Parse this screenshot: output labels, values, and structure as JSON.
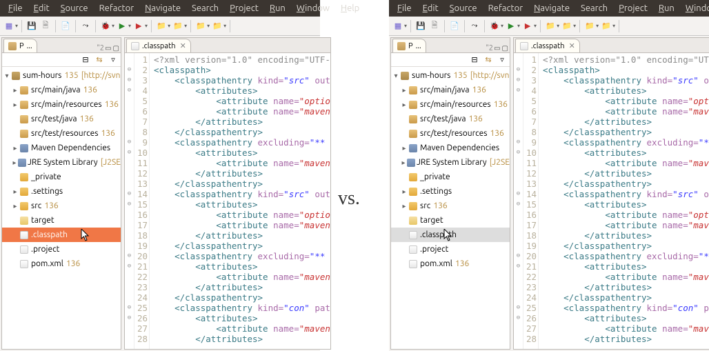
{
  "menus": [
    "File",
    "Edit",
    "Source",
    "Refactor",
    "Navigate",
    "Search",
    "Project",
    "Run",
    "Window",
    "Help"
  ],
  "menus_u": [
    "F",
    "E",
    "S",
    "",
    "N",
    "",
    "P",
    "R",
    "W",
    "H"
  ],
  "vs_label": "vs.",
  "project_tab": "P",
  "bc_label": "\"2",
  "editor_tab": ".classpath",
  "tree": {
    "root": {
      "label": "sum-hours",
      "rev": "135",
      "extra": "[http://svn"
    },
    "items": [
      {
        "label": "src/main/java",
        "rev": "136",
        "icon": "i-pkg",
        "tw": "▸"
      },
      {
        "label": "src/main/resources",
        "rev": "136",
        "icon": "i-pkg",
        "tw": "▸"
      },
      {
        "label": "src/test/java",
        "rev": "136",
        "icon": "i-pkg",
        "tw": ""
      },
      {
        "label": "src/test/resources",
        "rev": "136",
        "icon": "i-pkg",
        "tw": ""
      },
      {
        "label": "Maven Dependencies",
        "rev": "",
        "icon": "i-jar",
        "tw": "▸"
      },
      {
        "label": "JRE System Library",
        "rev": "",
        "extra": "[J2SE",
        "icon": "i-jar",
        "tw": "▸"
      },
      {
        "label": "_private",
        "rev": "",
        "icon": "i-folder",
        "tw": ""
      },
      {
        "label": ".settings",
        "rev": "",
        "icon": "i-folder",
        "tw": "▸"
      },
      {
        "label": "src",
        "rev": "136",
        "icon": "i-folder",
        "tw": "▸"
      },
      {
        "label": "target",
        "rev": "",
        "icon": "i-folder-tgt",
        "tw": ""
      },
      {
        "label": ".classpath",
        "rev": "",
        "icon": "i-file",
        "tw": "",
        "selected": true
      },
      {
        "label": ".project",
        "rev": "",
        "icon": "i-file",
        "tw": ""
      },
      {
        "label": "pom.xml",
        "rev": "136",
        "icon": "i-file",
        "tw": ""
      }
    ]
  },
  "code_lines": [
    {
      "n": 1,
      "f": "",
      "raw": "<span class='xdecl'>&lt;?xml version=&quot;1.0&quot; encoding=&quot;UTF-</span>"
    },
    {
      "n": 2,
      "f": "⊖",
      "raw": "<span class='tagc'>&lt;classpath&gt;</span>"
    },
    {
      "n": 3,
      "f": "⊖",
      "raw": "    <span class='tagc'>&lt;classpathentry</span> <span class='attn'>kind=</span><span class='attv'>&quot;src&quot;</span> <span class='attn'>out</span>"
    },
    {
      "n": 4,
      "f": "⊖",
      "raw": "        <span class='tagc'>&lt;attributes&gt;</span>"
    },
    {
      "n": 5,
      "f": "",
      "raw": "            <span class='tagc'>&lt;attribute</span> <span class='attn'>name=</span><span class='attv-red'>&quot;optio</span>"
    },
    {
      "n": 6,
      "f": "",
      "raw": "            <span class='tagc'>&lt;attribute</span> <span class='attn'>name=</span><span class='attv-red'>&quot;maven</span>"
    },
    {
      "n": 7,
      "f": "",
      "raw": "        <span class='tagc'>&lt;/attributes&gt;</span>"
    },
    {
      "n": 8,
      "f": "",
      "raw": "    <span class='tagc'>&lt;/classpathentry&gt;</span>"
    },
    {
      "n": 9,
      "f": "⊖",
      "raw": "    <span class='tagc'>&lt;classpathentry</span> <span class='attn'>excluding=</span><span class='attv'>&quot;**</span>"
    },
    {
      "n": 10,
      "f": "⊖",
      "raw": "        <span class='tagc'>&lt;attributes&gt;</span>"
    },
    {
      "n": 11,
      "f": "",
      "raw": "            <span class='tagc'>&lt;attribute</span> <span class='attn'>name=</span><span class='attv-red'>&quot;maven</span>"
    },
    {
      "n": 12,
      "f": "",
      "raw": "        <span class='tagc'>&lt;/attributes&gt;</span>"
    },
    {
      "n": 13,
      "f": "",
      "raw": "    <span class='tagc'>&lt;/classpathentry&gt;</span>"
    },
    {
      "n": 14,
      "f": "⊖",
      "raw": "    <span class='tagc'>&lt;classpathentry</span> <span class='attn'>kind=</span><span class='attv'>&quot;src&quot;</span> <span class='attn'>out</span>"
    },
    {
      "n": 15,
      "f": "⊖",
      "raw": "        <span class='tagc'>&lt;attributes&gt;</span>"
    },
    {
      "n": 16,
      "f": "",
      "raw": "            <span class='tagc'>&lt;attribute</span> <span class='attn'>name=</span><span class='attv-red'>&quot;optio</span>"
    },
    {
      "n": 17,
      "f": "",
      "raw": "            <span class='tagc'>&lt;attribute</span> <span class='attn'>name=</span><span class='attv-red'>&quot;maven</span>"
    },
    {
      "n": 18,
      "f": "",
      "raw": "        <span class='tagc'>&lt;/attributes&gt;</span>"
    },
    {
      "n": 19,
      "f": "",
      "raw": "    <span class='tagc'>&lt;/classpathentry&gt;</span>"
    },
    {
      "n": 20,
      "f": "⊖",
      "raw": "    <span class='tagc'>&lt;classpathentry</span> <span class='attn'>excluding=</span><span class='attv'>&quot;**</span>"
    },
    {
      "n": 21,
      "f": "⊖",
      "raw": "        <span class='tagc'>&lt;attributes&gt;</span>"
    },
    {
      "n": 22,
      "f": "",
      "raw": "            <span class='tagc'>&lt;attribute</span> <span class='attn'>name=</span><span class='attv-red'>&quot;maven</span>"
    },
    {
      "n": 23,
      "f": "",
      "raw": "        <span class='tagc'>&lt;/attributes&gt;</span>"
    },
    {
      "n": 24,
      "f": "",
      "raw": "    <span class='tagc'>&lt;/classpathentry&gt;</span>"
    },
    {
      "n": 25,
      "f": "⊖",
      "raw": "    <span class='tagc'>&lt;classpathentry</span> <span class='attn'>kind=</span><span class='attv'>&quot;con&quot;</span> <span class='attn'>pat</span>"
    },
    {
      "n": 26,
      "f": "⊖",
      "raw": "        <span class='tagc'>&lt;attributes&gt;</span>"
    },
    {
      "n": 27,
      "f": "",
      "raw": "            <span class='tagc'>&lt;attribute</span> <span class='attn'>name=</span><span class='attv-red'>&quot;maven</span>"
    },
    {
      "n": 28,
      "f": "",
      "raw": "        <span class='tagc'>&lt;/attributes&gt;</span>"
    }
  ]
}
